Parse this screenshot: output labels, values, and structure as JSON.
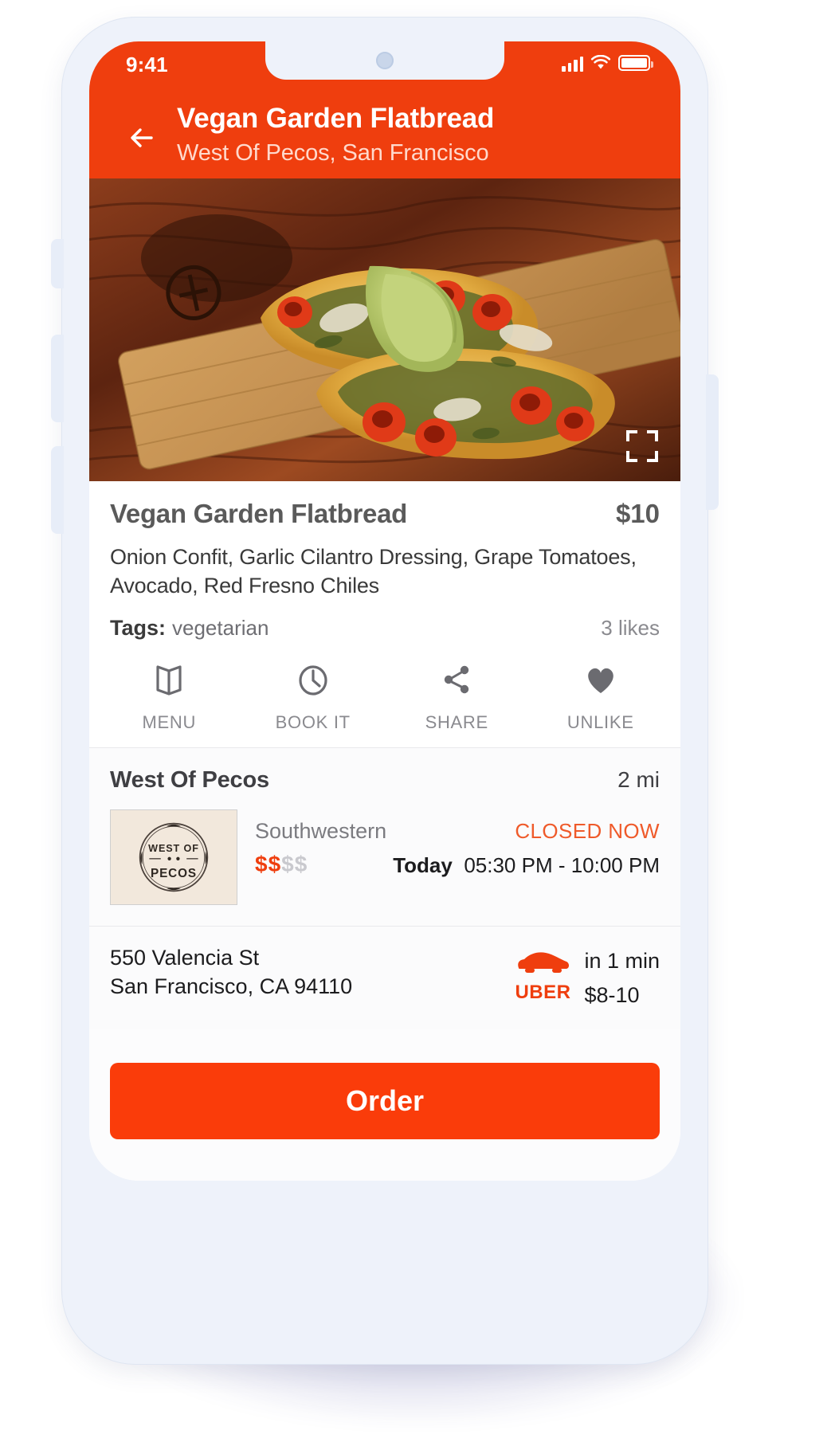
{
  "theme": {
    "brand": "#ef3e0e",
    "order_button": "#fa3c0a",
    "accent_text": "#ef5a2a"
  },
  "status_bar": {
    "time": "9:41",
    "icons": [
      "cellular-signal-icon",
      "wifi-icon",
      "battery-icon"
    ]
  },
  "header": {
    "back_icon": "back-arrow-icon",
    "title": "Vegan Garden Flatbread",
    "subtitle": "West Of Pecos, San Francisco"
  },
  "hero": {
    "alt": "Vegan Garden Flatbread on a wooden serving board",
    "expand_icon": "fullscreen-expand-icon"
  },
  "dish": {
    "name": "Vegan Garden Flatbread",
    "price": "$10",
    "description": "Onion Confit, Garlic Cilantro Dressing, Grape Tomatoes, Avocado, Red Fresno Chiles",
    "tags_label": "Tags:",
    "tags_value": "vegetarian",
    "likes": "3 likes"
  },
  "actions": [
    {
      "label": "MENU",
      "icon": "open-book-icon"
    },
    {
      "label": "BOOK IT",
      "icon": "clock-icon"
    },
    {
      "label": "SHARE",
      "icon": "share-nodes-icon"
    },
    {
      "label": "UNLIKE",
      "icon": "heart-filled-icon"
    }
  ],
  "restaurant": {
    "name": "West Of Pecos",
    "distance": "2 mi",
    "logo_line1": "WEST OF",
    "logo_line2": "PECOS",
    "cuisine": "Southwestern",
    "price_range_filled": "$$",
    "price_range_empty": "$$",
    "status": "CLOSED NOW",
    "hours_day": "Today",
    "hours_range": "05:30 PM - 10:00 PM",
    "address_line1": "550 Valencia St",
    "address_line2": "San Francisco, CA 94110"
  },
  "uber": {
    "icon": "car-icon",
    "brand": "UBER",
    "eta": "in 1 min",
    "cost": "$8-10"
  },
  "footer": {
    "order_label": "Order"
  }
}
